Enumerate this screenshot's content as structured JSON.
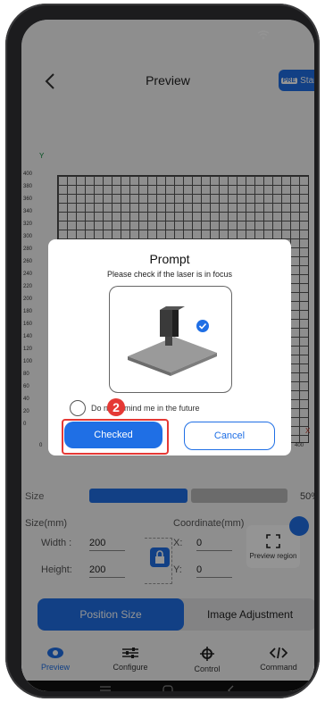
{
  "header": {
    "title": "Preview",
    "start_label": "Start",
    "start_icon_label": "PRE"
  },
  "grid": {
    "y_axis_letter": "Y",
    "x_axis_letter": "X",
    "y_ticks": [
      "400",
      "380",
      "360",
      "340",
      "320",
      "300",
      "280",
      "260",
      "240",
      "220",
      "200",
      "180",
      "160",
      "140",
      "120",
      "100",
      "80",
      "60",
      "40",
      "20",
      "0"
    ],
    "x_ticks": [
      "0",
      "400"
    ]
  },
  "dialog": {
    "title": "Prompt",
    "subtitle": "Please check if the laser is in focus",
    "remind_text": "Do not remind me in the future",
    "badge": "2",
    "confirm_label": "Checked",
    "cancel_label": "Cancel"
  },
  "controls": {
    "size_label": "Size",
    "size_percent": "50%",
    "size_mm_label": "Size(mm)",
    "coordinate_label": "Coordinate(mm)",
    "width_label": "Width :",
    "width_value": "200",
    "height_label": "Height:",
    "height_value": "200",
    "x_label": "X:",
    "x_value": "0",
    "y_label": "Y:",
    "y_value": "0",
    "preview_region_label": "Preview region"
  },
  "tabs": {
    "position_size": "Position Size",
    "image_adjustment": "Image Adjustment"
  },
  "nav": [
    {
      "label": "Preview",
      "icon": "eye-icon",
      "active": true
    },
    {
      "label": "Configure",
      "icon": "sliders-icon",
      "active": false
    },
    {
      "label": "Control",
      "icon": "crosshair-icon",
      "active": false
    },
    {
      "label": "Command",
      "icon": "code-icon",
      "active": false
    }
  ],
  "colors": {
    "accent": "#1f6fe5",
    "highlight": "#e53935"
  }
}
